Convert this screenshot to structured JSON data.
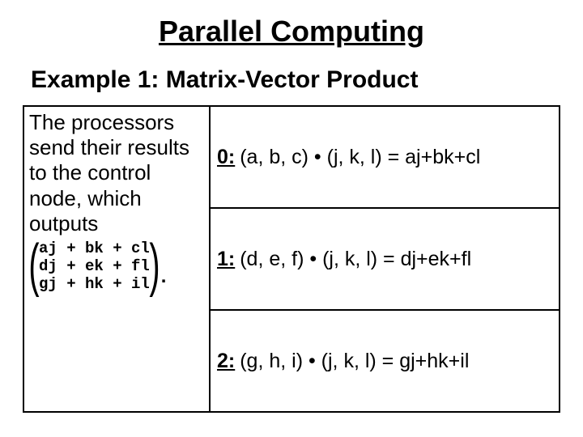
{
  "title": "Parallel Computing",
  "subtitle": "Example 1: Matrix-Vector Product",
  "description": "The processors send their results to the control node, which outputs",
  "matrix": {
    "row0": "aj + bk + cl",
    "row1": "dj + ek + fl",
    "row2": "gj + hk + il"
  },
  "period": ".",
  "processors": [
    {
      "label": "0:",
      "text": "(a, b, c) • (j, k, l) = aj+bk+cl"
    },
    {
      "label": "1:",
      "text": "(d, e, f) • (j, k, l) = dj+ek+fl"
    },
    {
      "label": "2:",
      "text": "(g, h, i) • (j, k, l) = gj+hk+il"
    }
  ]
}
